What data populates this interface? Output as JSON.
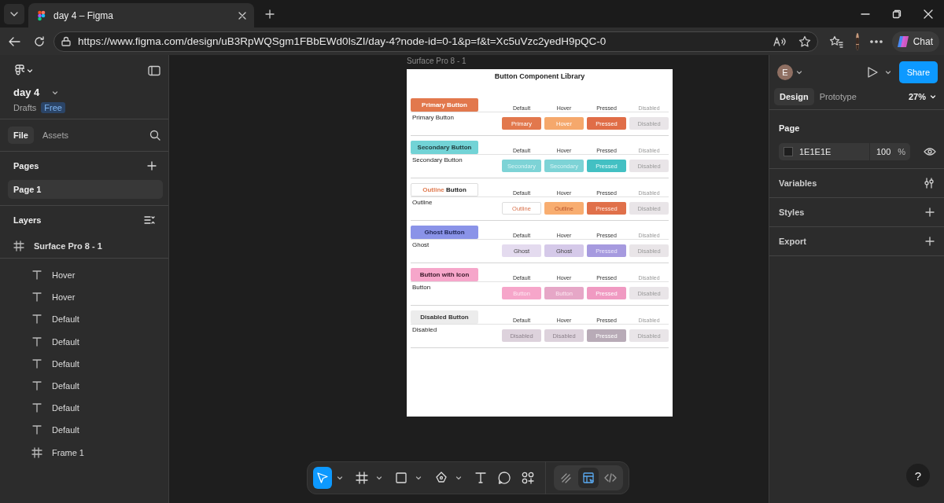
{
  "browser": {
    "tabs": [
      {
        "title": "day 4 – Figma",
        "selected": true
      }
    ],
    "url": "https://www.figma.com/design/uB3RpWQSgm1FBbEWd0lsZI/day-4?node-id=0-1&p=f&t=Xc5uVzc2yedH9pQC-0",
    "chat_button": "Chat"
  },
  "file": {
    "name": "day 4",
    "location": "Drafts",
    "plan_badge": "Free"
  },
  "left_tabs": [
    {
      "label": "File",
      "selected": true
    },
    {
      "label": "Assets",
      "selected": false
    }
  ],
  "pages": {
    "title": "Pages",
    "items": [
      {
        "name": "Page 1",
        "selected": true
      }
    ]
  },
  "layers": {
    "title": "Layers",
    "items": [
      {
        "kind": "frame",
        "name": "Surface Pro 8 - 1",
        "children": [
          {
            "kind": "text",
            "name": "Hover"
          },
          {
            "kind": "text",
            "name": "Hover"
          },
          {
            "kind": "text",
            "name": "Default"
          },
          {
            "kind": "text",
            "name": "Default"
          },
          {
            "kind": "text",
            "name": "Default"
          },
          {
            "kind": "text",
            "name": "Default"
          },
          {
            "kind": "text",
            "name": "Default"
          },
          {
            "kind": "text",
            "name": "Default"
          },
          {
            "kind": "frame",
            "name": "Frame 1"
          }
        ]
      }
    ]
  },
  "canvas": {
    "frame_label": "Surface Pro 8 - 1",
    "frame": {
      "title": "Button Component Library",
      "sections": [
        {
          "kind": "primary",
          "header": "Primary Button",
          "label": "Primary Button",
          "states": [
            "Default",
            "Hover",
            "Pressed",
            "Disabled"
          ],
          "buttons": [
            "Primary",
            "Hover",
            "Pressed",
            "Disabled"
          ]
        },
        {
          "kind": "secondary",
          "header": "Secondary Button",
          "label": "Secondary Button",
          "states": [
            "Default",
            "Hover",
            "Pressed",
            "Disabled"
          ],
          "buttons": [
            "Secondary",
            "Secondary",
            "Pressed",
            "Disabled"
          ]
        },
        {
          "kind": "outline",
          "header_accent": "Outline",
          "header": "Button",
          "label": "Outline",
          "states": [
            "Default",
            "Hover",
            "Pressed",
            "Disabled"
          ],
          "buttons": [
            "Outline",
            "Outline",
            "Pressed",
            "Disabled"
          ]
        },
        {
          "kind": "ghost",
          "header": "Ghost Button",
          "label": "Ghost",
          "states": [
            "Default",
            "Hover",
            "Pressed",
            "Disabled"
          ],
          "buttons": [
            "Ghost",
            "Ghost",
            "Pressed",
            "Disabled"
          ]
        },
        {
          "kind": "icon",
          "header": "Button with Icon",
          "label": "Button",
          "states": [
            "Default",
            "Hover",
            "Pressed",
            "Disabled"
          ],
          "buttons": [
            "Button",
            "Button",
            "Pressed",
            "Disabled"
          ]
        },
        {
          "kind": "disabled",
          "header": "Disabled Button",
          "label": "Disabled",
          "states": [
            "Default",
            "Hover",
            "Pressed",
            "Disabled"
          ],
          "buttons": [
            "Disabled",
            "Disabled",
            "Pressed",
            "Disabled"
          ]
        }
      ]
    }
  },
  "right_panel": {
    "avatar": "E",
    "share_button": "Share",
    "tabs": [
      {
        "label": "Design",
        "selected": true
      },
      {
        "label": "Prototype",
        "selected": false
      }
    ],
    "zoom": "27%",
    "page": {
      "title": "Page",
      "color": "1E1E1E",
      "opacity": "100",
      "unit": "%"
    },
    "sections": [
      {
        "title": "Variables",
        "kind": "variables"
      },
      {
        "title": "Styles",
        "kind": "add"
      },
      {
        "title": "Export",
        "kind": "add"
      }
    ]
  },
  "toolbar": {
    "tools": [
      {
        "kind": "move",
        "selected": true,
        "menu": true
      },
      {
        "kind": "frame",
        "selected": false,
        "menu": true
      },
      {
        "kind": "shape",
        "selected": false,
        "menu": true
      },
      {
        "kind": "pen",
        "selected": false,
        "menu": true
      },
      {
        "kind": "text",
        "selected": false,
        "menu": false
      },
      {
        "kind": "comment",
        "selected": false,
        "menu": false
      },
      {
        "kind": "components",
        "selected": false,
        "menu": false
      }
    ],
    "modes": [
      {
        "kind": "draw",
        "selected": false
      },
      {
        "kind": "design",
        "selected": true
      },
      {
        "kind": "dev",
        "selected": false
      }
    ]
  },
  "help_button": "?"
}
